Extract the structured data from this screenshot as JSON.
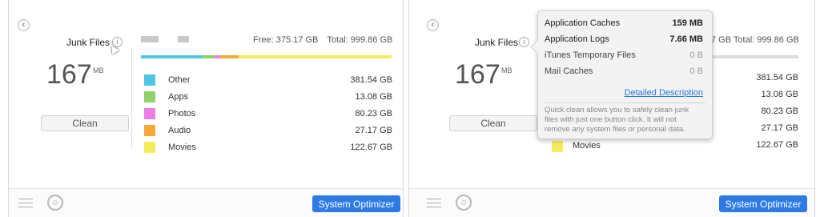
{
  "left": {
    "title": "Junk Files",
    "info": "i",
    "size_value": "167",
    "size_unit": "MB",
    "clean_label": "Clean",
    "disk_free": "Free: 375.17 GB",
    "disk_total": "Total: 999.86 GB",
    "categories": [
      {
        "label": "Other",
        "value": "381.54 GB",
        "color": "#4fc6e1"
      },
      {
        "label": "Apps",
        "value": "13.08 GB",
        "color": "#8fd16a"
      },
      {
        "label": "Photos",
        "value": "80.23 GB",
        "color": "#ec7fe6"
      },
      {
        "label": "Audio",
        "value": "27.17 GB",
        "color": "#f6a93a"
      },
      {
        "label": "Movies",
        "value": "122.67 GB",
        "color": "#f4ec5a"
      }
    ],
    "footer_button": "System Optimizer"
  },
  "right": {
    "title": "Junk Files",
    "info": "i",
    "size_value": "167",
    "size_unit": "MB",
    "clean_label": "Clean",
    "disk_total_partial": "7 GB   Total: 999.86 GB",
    "visible_values": [
      "381.54 GB",
      "13.08 GB",
      "80.23 GB",
      "27.17 GB",
      "122.67 GB"
    ],
    "movies_label": "Movies",
    "movies_color": "#f4ec5a",
    "footer_button": "System Optimizer"
  },
  "tooltip": {
    "rows": [
      {
        "label": "Application Caches",
        "value": "159 MB"
      },
      {
        "label": "Application Logs",
        "value": "7.66 MB"
      },
      {
        "label": "iTunes Temporary Files",
        "value": "0 B"
      },
      {
        "label": "Mail Caches",
        "value": "0 B"
      }
    ],
    "link": "Detailed Description",
    "note": "Quick clean allows you to safely clean junk files with just one button click. It will not remove any system files or personal data."
  },
  "icons": {
    "back": "‹",
    "robot": "☺"
  },
  "disk_usage_fractions": [
    0.245,
    0.05,
    0.02,
    0.075,
    0.61
  ]
}
